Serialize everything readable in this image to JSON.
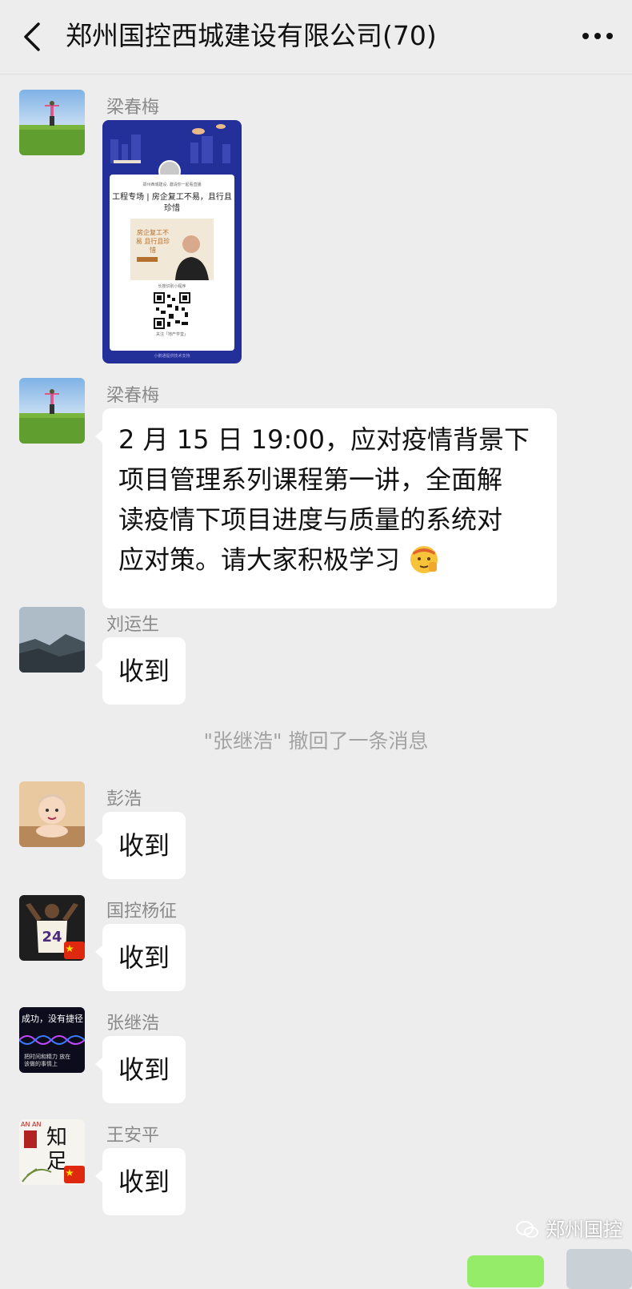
{
  "header": {
    "title": "郑州国控西城建设有限公司(70)"
  },
  "messages": [
    {
      "sender": "梁春梅",
      "type": "image",
      "poster": {
        "top_line": "郑州西城建设, 邀请你一起看直播",
        "headline": "工程专场 | 房企复工不易，且行且珍惜",
        "photo_caption": "房企复工不易 且行且珍惜",
        "scan_hint": "长按识别小程序",
        "follow_hint": "关注「地产学堂」",
        "footer": "小鹅通提供技术支持"
      }
    },
    {
      "sender": "梁春梅",
      "type": "text",
      "lines": [
        "2 月 15 日 19:00，应对疫情背景下",
        "项目管理系列课程第一讲，全面解",
        "读疫情下项目进度与质量的系统对",
        "应对策。请大家积极学习"
      ],
      "emoji": "salute-face-emoji"
    },
    {
      "sender": "刘运生",
      "type": "text",
      "text": "收到"
    },
    {
      "sender": "彭浩",
      "type": "text",
      "text": "收到"
    },
    {
      "sender": "国控杨征",
      "type": "text",
      "text": "收到"
    },
    {
      "sender": "张继浩",
      "type": "text",
      "text": "收到"
    },
    {
      "sender": "王安平",
      "type": "text",
      "text": "收到"
    }
  ],
  "system_note": "\"张继浩\" 撤回了一条消息",
  "avatars": {
    "zhang_jihao_text_top": "成功，没有捷径",
    "zhang_jihao_text_bottom": "把时间和精力 放在该做的事情上",
    "wang_anping_text": "知足",
    "wang_anping_corner": "AN AN",
    "yang_zheng_jersey": "24"
  },
  "watermark": "郑州国控",
  "colors": {
    "background": "#ededed",
    "bubble": "#ffffff",
    "sent_bubble": "#95ec69",
    "sender_name": "#8a8a8a",
    "system_note": "#a3a3a3",
    "poster_blue": "#24309a"
  }
}
